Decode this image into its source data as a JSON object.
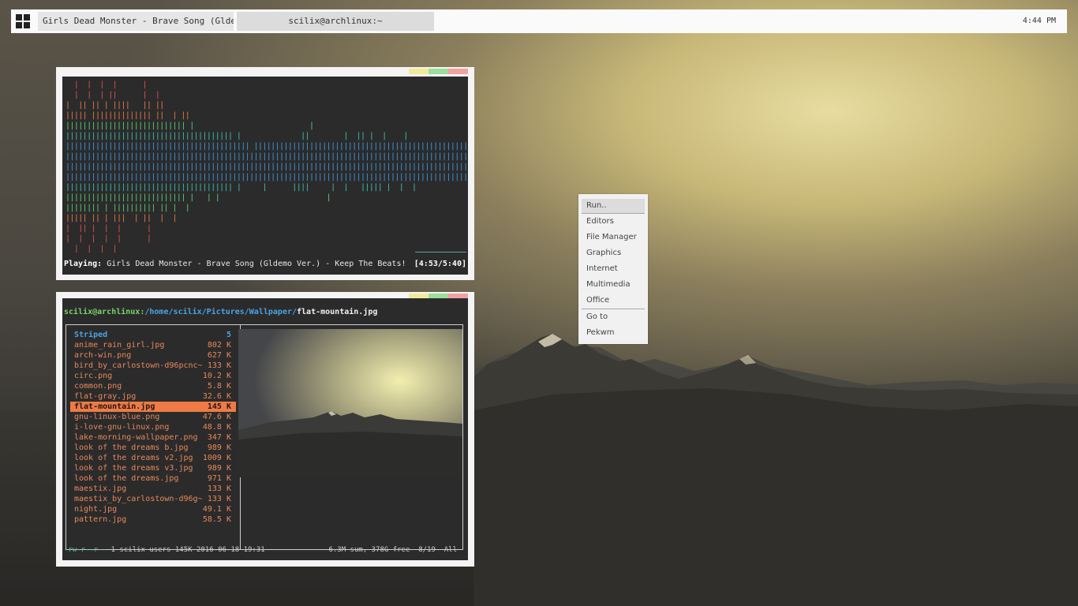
{
  "taskbar": {
    "tasks": [
      "Girls Dead Monster - Brave Song (Glde...",
      "scilix@archlinux:~"
    ],
    "clock": "4:44 PM"
  },
  "colors": {
    "red": "#e0554f",
    "orange": "#f07a45",
    "green": "#5dd37a",
    "teal": "#3cc3b6",
    "blue": "#3d9be6",
    "btn_yellow": "#f2ea9a",
    "btn_green": "#9cde9c",
    "btn_red": "#f1a1a1"
  },
  "music": {
    "visualizer_rows": [
      "  |  |  |  |      |",
      "  |  |  | ||      |  |",
      "|  || || | ||||   || ||",
      "||||| |||||||||||||| ||  | ||",
      "|||||||||||||||||||||||||||| |                           |",
      "||||||||||||||||||||||||||||||||||||||| |              ||        |  || |  |    |",
      "||||||||||||||||||||||||||||||||||||||||||| |||||||||||||||||||||||||||||||||||||||||||||||||||||||",
      "||||||||||||||||||||||||||||||||||||||||||||||||||||||||||||||||||||||||||||||||||||||||||||||||||||",
      "||||||||||||||||||||||||||||||||||||||||||||||||||||||||||||||||||||||||||||||||||||||||||||||||||||",
      "||||||||||||||||||||||||||||||||||||||||||||||||||||||||||||||||||||||||||||||||||||||||||||||||||||",
      "||||||||||||||||||||||||||||||||||||||| |     |      ||||     |  |   ||||| |  |  |",
      "|||||||||||||||||||||||||||| |   | |                         |",
      "|||||||| | |||||||||| || |  |",
      "||||| || | |||  | ||  |  |",
      "|  || |  |  |      |",
      "|  |  |  |  |      |",
      "  |  |  |  |"
    ],
    "playing_label": "Playing:",
    "track": "Girls Dead Monster - Brave Song (Gldemo Ver.) - Keep The Beats!",
    "time": "[4:53/5:40]",
    "progress_fraction": 0.86
  },
  "ranger": {
    "prompt_user": "scilix@archlinux:",
    "prompt_dir": "/home/scilix/Pictures/Wallpaper/",
    "prompt_file": "flat-mountain.jpg",
    "files": [
      {
        "name": "Striped",
        "size": "5",
        "type": "dir"
      },
      {
        "name": "anime_rain_girl.jpg",
        "size": "802 K"
      },
      {
        "name": "arch-win.png",
        "size": "627 K"
      },
      {
        "name": "bird_by_carlostown-d96pcnc~",
        "size": "133 K"
      },
      {
        "name": "circ.png",
        "size": "10.2 K"
      },
      {
        "name": "common.png",
        "size": "5.8 K"
      },
      {
        "name": "flat-gray.jpg",
        "size": "32.6 K"
      },
      {
        "name": "flat-mountain.jpg",
        "size": "145 K",
        "selected": true
      },
      {
        "name": "gnu-linux-blue.png",
        "size": "47.6 K"
      },
      {
        "name": "i-love-gnu-linux.png",
        "size": "48.8 K"
      },
      {
        "name": "lake-morning-wallpaper.png",
        "size": "347 K"
      },
      {
        "name": "look of the dreams b.jpg",
        "size": "989 K"
      },
      {
        "name": "look of the dreams v2.jpg",
        "size": "1009 K"
      },
      {
        "name": "look of the dreams v3.jpg",
        "size": "989 K"
      },
      {
        "name": "look of the dreams.jpg",
        "size": "971 K"
      },
      {
        "name": "maestix.jpg",
        "size": "133 K"
      },
      {
        "name": "maestix_by_carlostown-d96g~",
        "size": "133 K"
      },
      {
        "name": "night.jpg",
        "size": "49.1 K"
      },
      {
        "name": "pattern.jpg",
        "size": "58.5 K"
      }
    ],
    "status_perm": "-rw-r--r--",
    "status_info": " 1 scilix users 145K 2016-06-18 19:31",
    "status_right": "6.3M sum, 378G free  8/19  All"
  },
  "rootmenu": {
    "items": [
      "Run..",
      "Editors",
      "File Manager",
      "Graphics",
      "Internet",
      "Multimedia",
      "Office",
      "Go to",
      "Pekwm"
    ]
  }
}
